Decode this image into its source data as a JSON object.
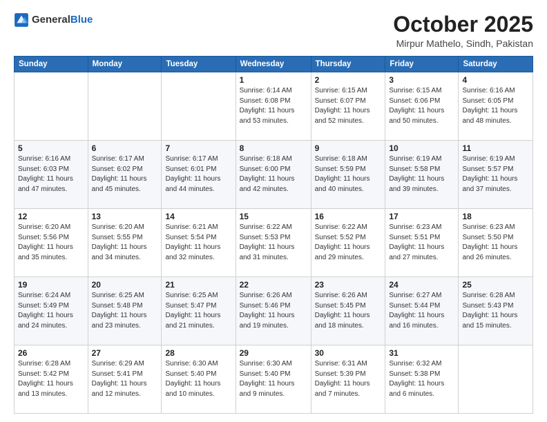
{
  "header": {
    "logo_general": "General",
    "logo_blue": "Blue",
    "month_title": "October 2025",
    "location": "Mirpur Mathelo, Sindh, Pakistan"
  },
  "weekdays": [
    "Sunday",
    "Monday",
    "Tuesday",
    "Wednesday",
    "Thursday",
    "Friday",
    "Saturday"
  ],
  "weeks": [
    [
      {
        "day": "",
        "info": ""
      },
      {
        "day": "",
        "info": ""
      },
      {
        "day": "",
        "info": ""
      },
      {
        "day": "1",
        "info": "Sunrise: 6:14 AM\nSunset: 6:08 PM\nDaylight: 11 hours\nand 53 minutes."
      },
      {
        "day": "2",
        "info": "Sunrise: 6:15 AM\nSunset: 6:07 PM\nDaylight: 11 hours\nand 52 minutes."
      },
      {
        "day": "3",
        "info": "Sunrise: 6:15 AM\nSunset: 6:06 PM\nDaylight: 11 hours\nand 50 minutes."
      },
      {
        "day": "4",
        "info": "Sunrise: 6:16 AM\nSunset: 6:05 PM\nDaylight: 11 hours\nand 48 minutes."
      }
    ],
    [
      {
        "day": "5",
        "info": "Sunrise: 6:16 AM\nSunset: 6:03 PM\nDaylight: 11 hours\nand 47 minutes."
      },
      {
        "day": "6",
        "info": "Sunrise: 6:17 AM\nSunset: 6:02 PM\nDaylight: 11 hours\nand 45 minutes."
      },
      {
        "day": "7",
        "info": "Sunrise: 6:17 AM\nSunset: 6:01 PM\nDaylight: 11 hours\nand 44 minutes."
      },
      {
        "day": "8",
        "info": "Sunrise: 6:18 AM\nSunset: 6:00 PM\nDaylight: 11 hours\nand 42 minutes."
      },
      {
        "day": "9",
        "info": "Sunrise: 6:18 AM\nSunset: 5:59 PM\nDaylight: 11 hours\nand 40 minutes."
      },
      {
        "day": "10",
        "info": "Sunrise: 6:19 AM\nSunset: 5:58 PM\nDaylight: 11 hours\nand 39 minutes."
      },
      {
        "day": "11",
        "info": "Sunrise: 6:19 AM\nSunset: 5:57 PM\nDaylight: 11 hours\nand 37 minutes."
      }
    ],
    [
      {
        "day": "12",
        "info": "Sunrise: 6:20 AM\nSunset: 5:56 PM\nDaylight: 11 hours\nand 35 minutes."
      },
      {
        "day": "13",
        "info": "Sunrise: 6:20 AM\nSunset: 5:55 PM\nDaylight: 11 hours\nand 34 minutes."
      },
      {
        "day": "14",
        "info": "Sunrise: 6:21 AM\nSunset: 5:54 PM\nDaylight: 11 hours\nand 32 minutes."
      },
      {
        "day": "15",
        "info": "Sunrise: 6:22 AM\nSunset: 5:53 PM\nDaylight: 11 hours\nand 31 minutes."
      },
      {
        "day": "16",
        "info": "Sunrise: 6:22 AM\nSunset: 5:52 PM\nDaylight: 11 hours\nand 29 minutes."
      },
      {
        "day": "17",
        "info": "Sunrise: 6:23 AM\nSunset: 5:51 PM\nDaylight: 11 hours\nand 27 minutes."
      },
      {
        "day": "18",
        "info": "Sunrise: 6:23 AM\nSunset: 5:50 PM\nDaylight: 11 hours\nand 26 minutes."
      }
    ],
    [
      {
        "day": "19",
        "info": "Sunrise: 6:24 AM\nSunset: 5:49 PM\nDaylight: 11 hours\nand 24 minutes."
      },
      {
        "day": "20",
        "info": "Sunrise: 6:25 AM\nSunset: 5:48 PM\nDaylight: 11 hours\nand 23 minutes."
      },
      {
        "day": "21",
        "info": "Sunrise: 6:25 AM\nSunset: 5:47 PM\nDaylight: 11 hours\nand 21 minutes."
      },
      {
        "day": "22",
        "info": "Sunrise: 6:26 AM\nSunset: 5:46 PM\nDaylight: 11 hours\nand 19 minutes."
      },
      {
        "day": "23",
        "info": "Sunrise: 6:26 AM\nSunset: 5:45 PM\nDaylight: 11 hours\nand 18 minutes."
      },
      {
        "day": "24",
        "info": "Sunrise: 6:27 AM\nSunset: 5:44 PM\nDaylight: 11 hours\nand 16 minutes."
      },
      {
        "day": "25",
        "info": "Sunrise: 6:28 AM\nSunset: 5:43 PM\nDaylight: 11 hours\nand 15 minutes."
      }
    ],
    [
      {
        "day": "26",
        "info": "Sunrise: 6:28 AM\nSunset: 5:42 PM\nDaylight: 11 hours\nand 13 minutes."
      },
      {
        "day": "27",
        "info": "Sunrise: 6:29 AM\nSunset: 5:41 PM\nDaylight: 11 hours\nand 12 minutes."
      },
      {
        "day": "28",
        "info": "Sunrise: 6:30 AM\nSunset: 5:40 PM\nDaylight: 11 hours\nand 10 minutes."
      },
      {
        "day": "29",
        "info": "Sunrise: 6:30 AM\nSunset: 5:40 PM\nDaylight: 11 hours\nand 9 minutes."
      },
      {
        "day": "30",
        "info": "Sunrise: 6:31 AM\nSunset: 5:39 PM\nDaylight: 11 hours\nand 7 minutes."
      },
      {
        "day": "31",
        "info": "Sunrise: 6:32 AM\nSunset: 5:38 PM\nDaylight: 11 hours\nand 6 minutes."
      },
      {
        "day": "",
        "info": ""
      }
    ]
  ]
}
